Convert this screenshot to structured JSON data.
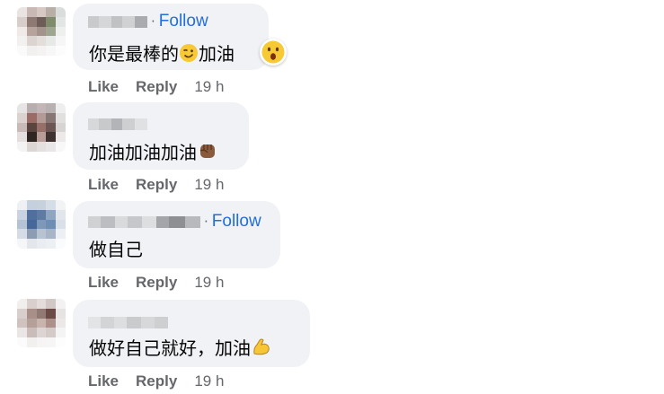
{
  "comments": [
    {
      "follow": "Follow",
      "text": "你是最棒的",
      "text_after": "加油",
      "emoji_inline": "winking-face",
      "reaction": "astonished-face",
      "like": "Like",
      "reply": "Reply",
      "time": "19 h"
    },
    {
      "text": "加油加油加油",
      "emoji_inline": "raised-fist",
      "like": "Like",
      "reply": "Reply",
      "time": "19 h"
    },
    {
      "follow": "Follow",
      "text": "做自己",
      "like": "Like",
      "reply": "Reply",
      "time": "19 h"
    },
    {
      "text": "做好自己就好，加油",
      "emoji_inline": "flexed-biceps",
      "like": "Like",
      "reply": "Reply",
      "time": "19 h"
    }
  ],
  "colors": {
    "bubble": "#f0f2f5",
    "follow": "#216fdb",
    "meta": "#65676b",
    "text": "#050505"
  }
}
